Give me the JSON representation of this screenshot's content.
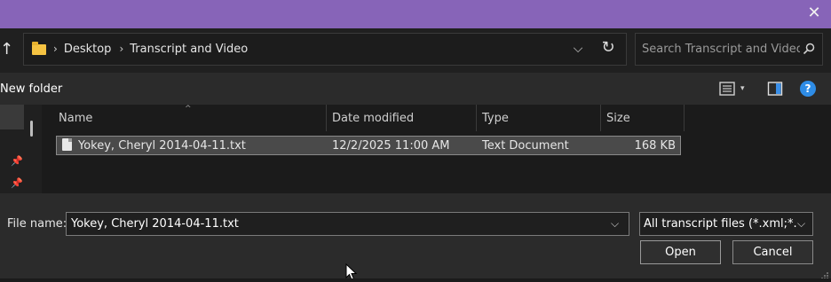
{
  "dialog": {
    "accent_color": "#8764b8"
  },
  "address_bar": {
    "crumbs": [
      "Desktop",
      "Transcript and Video"
    ]
  },
  "search": {
    "placeholder": "Search Transcript and Video"
  },
  "toolbar": {
    "new_folder_label": "New folder"
  },
  "file_list": {
    "columns": [
      "Name",
      "Date modified",
      "Type",
      "Size"
    ],
    "rows": [
      {
        "name": "Yokey, Cheryl 2014-04-11.txt",
        "date_modified": "12/2/2025 11:00 AM",
        "type": "Text Document",
        "size": "168 KB",
        "selected": true
      }
    ]
  },
  "bottom": {
    "file_name_label": "File name:",
    "file_name_value": "Yokey, Cheryl 2014-04-11.txt",
    "filter_selected": "All transcript files (*.xml;*.txt;",
    "open_label": "Open",
    "cancel_label": "Cancel"
  },
  "icons": {
    "close": "close-icon",
    "up": "up-arrow-icon",
    "folder": "folder-icon",
    "refresh": "refresh-icon",
    "search": "search-icon",
    "view": "view-options-icon",
    "preview": "preview-pane-icon",
    "help": "help-icon",
    "pin": "pin-icon",
    "file": "text-file-icon"
  }
}
